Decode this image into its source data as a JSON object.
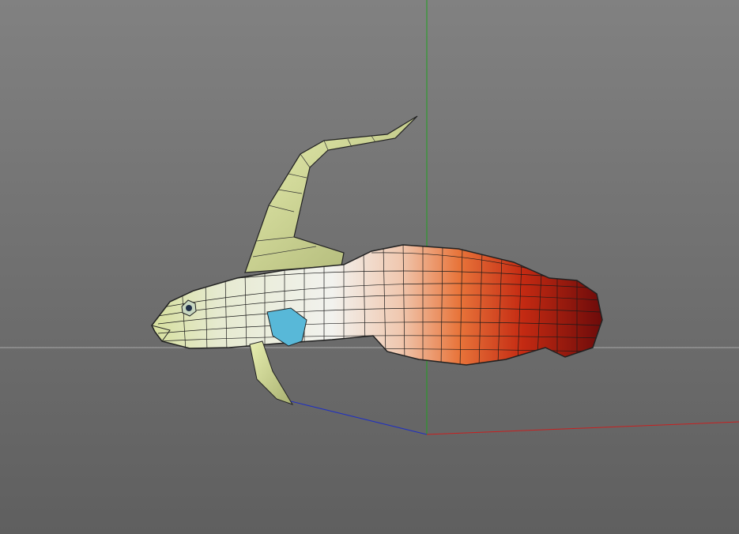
{
  "viewport": {
    "background_top": "#818181",
    "background_bottom": "#5f5f5f",
    "horizon_color": "#a8a8a8",
    "axes": {
      "x_color": "#c82020",
      "y_color": "#20a020",
      "z_color": "#2030c0"
    },
    "model": {
      "name_icon": "fish-mesh",
      "colors": [
        "#d6df9c",
        "#eeeee6",
        "#f0d0b8",
        "#e8743a",
        "#c42a12",
        "#6a0a0a"
      ]
    }
  }
}
